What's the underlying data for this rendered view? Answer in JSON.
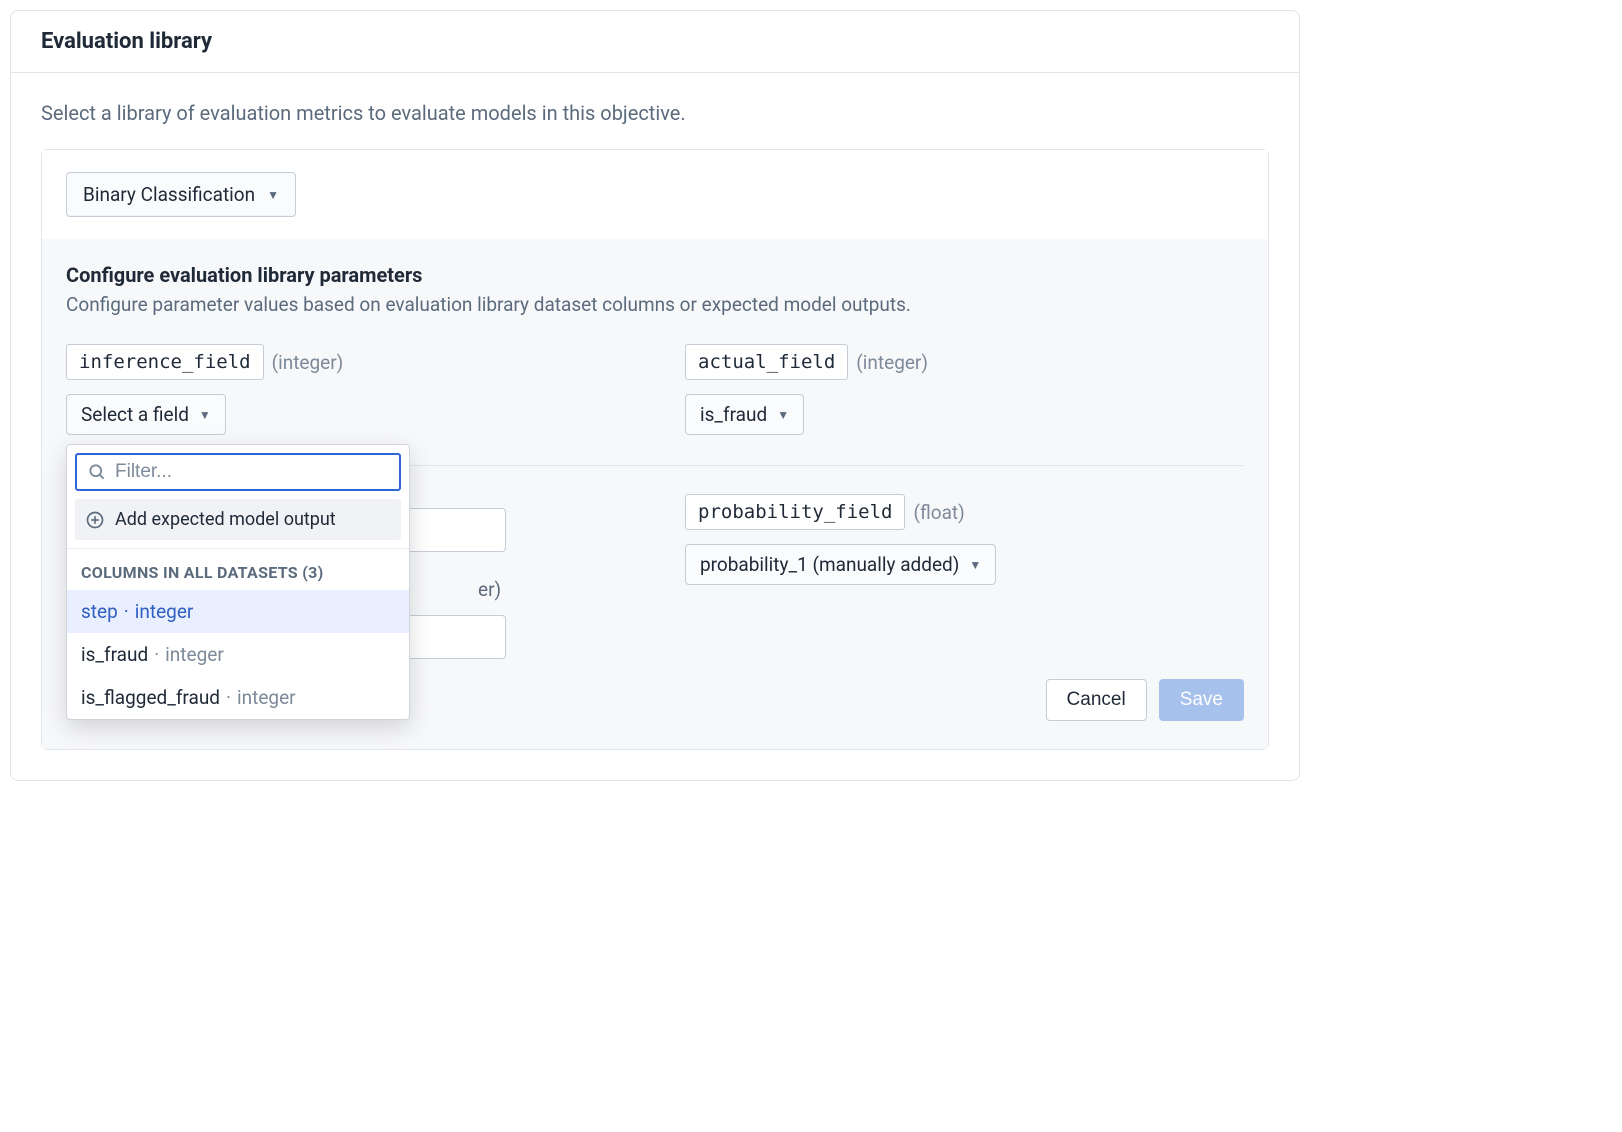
{
  "header": {
    "title": "Evaluation library"
  },
  "intro": "Select a library of evaluation metrics to evaluate models in this objective.",
  "library_dropdown": {
    "selected": "Binary Classification"
  },
  "params_section": {
    "heading": "Configure evaluation library parameters",
    "sub": "Configure parameter values based on evaluation library dataset columns or expected model outputs."
  },
  "params": {
    "inference_field": {
      "name": "inference_field",
      "type": "(integer)",
      "select_label": "Select a field"
    },
    "actual_field": {
      "name": "actual_field",
      "type": "(integer)",
      "select_label": "is_fraud"
    },
    "probability_field": {
      "name": "probability_field",
      "type": "(float)",
      "select_label": "probability_1 (manually added)"
    },
    "hidden_third": {
      "type_fragment": "er)"
    }
  },
  "popover": {
    "filter_placeholder": "Filter...",
    "add_label": "Add expected model output",
    "section_header": "COLUMNS IN ALL DATASETS (3)",
    "items": [
      {
        "name": "step",
        "type": "integer",
        "highlight": true
      },
      {
        "name": "is_fraud",
        "type": "integer",
        "highlight": false
      },
      {
        "name": "is_flagged_fraud",
        "type": "integer",
        "highlight": false
      }
    ]
  },
  "footer": {
    "cancel": "Cancel",
    "save": "Save"
  }
}
